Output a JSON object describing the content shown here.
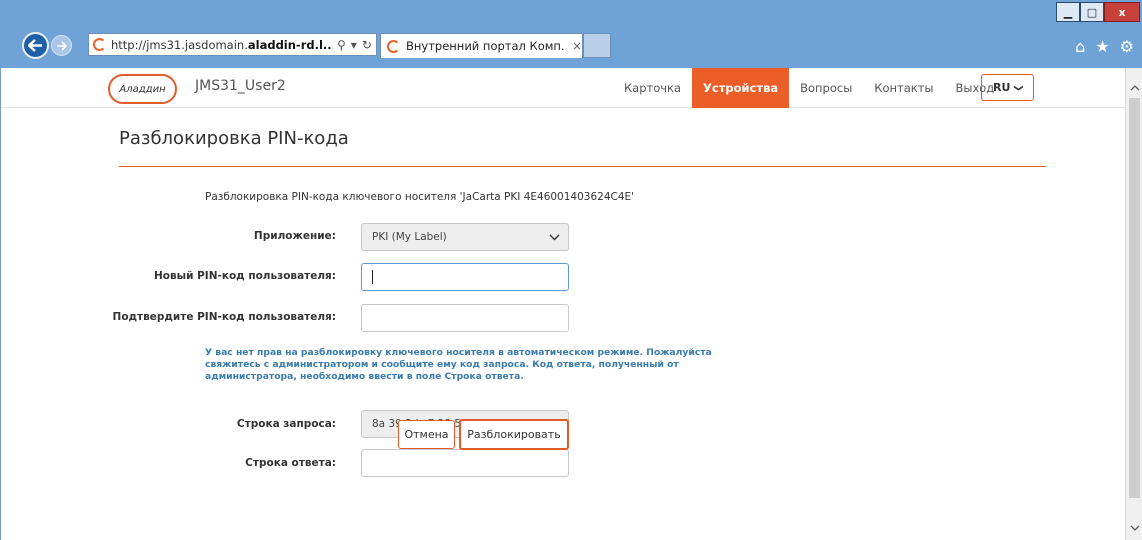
{
  "browser": {
    "url_prefix": "http://jms31.jasdomain.",
    "url_bold": "aladdin-rd.l...",
    "tab_title": "Внутренний портал Комп...",
    "tab_close": "×",
    "search_glyph": "⚲",
    "dropdown_glyph": "▾",
    "refresh_glyph": "↻",
    "home_glyph": "⌂",
    "star_glyph": "★",
    "gear_glyph": "⚙",
    "minimize_glyph": "▁",
    "maximize_glyph": "□",
    "close_glyph": "x"
  },
  "header": {
    "logo_text": "Аладдин",
    "username": "JMS31_User2",
    "nav": [
      {
        "label": "Карточка",
        "active": false
      },
      {
        "label": "Устройства",
        "active": true
      },
      {
        "label": "Вопросы",
        "active": false
      },
      {
        "label": "Контакты",
        "active": false
      },
      {
        "label": "Выход",
        "active": false
      }
    ],
    "lang": "RU",
    "lang_chevron": "❯"
  },
  "page": {
    "title": "Разблокировка PIN-кода",
    "subtitle": "Разблокировка PIN-кода ключевого носителя 'JaCarta PKI 4E46001403624C4E'"
  },
  "form": {
    "app_label": "Приложение:",
    "app_value": "PKI (My Label)",
    "new_pin_label": "Новый PIN-код пользователя:",
    "new_pin_value": "",
    "confirm_pin_label": "Подтвердите PIN-код пользователя:",
    "confirm_pin_value": "",
    "notice": "У вас нет прав на разблокировку ключевого носителя в автоматическом режиме. Пожалуйста свяжитесь с администратором и сообщите ему код запроса. Код ответа, полученный от администратора, необходимо ввести в поле Строка ответа.",
    "request_label": "Строка запроса:",
    "request_value": "8a 39 3d c7 28 58 c9 bb",
    "response_label": "Строка ответа:",
    "response_value": "",
    "cancel_label": "Отмена",
    "unlock_label": "Разблокировать"
  },
  "colors": {
    "accent": "#ec5e27",
    "notice_text": "#3a7cae",
    "chrome": "#6fa3d8"
  }
}
